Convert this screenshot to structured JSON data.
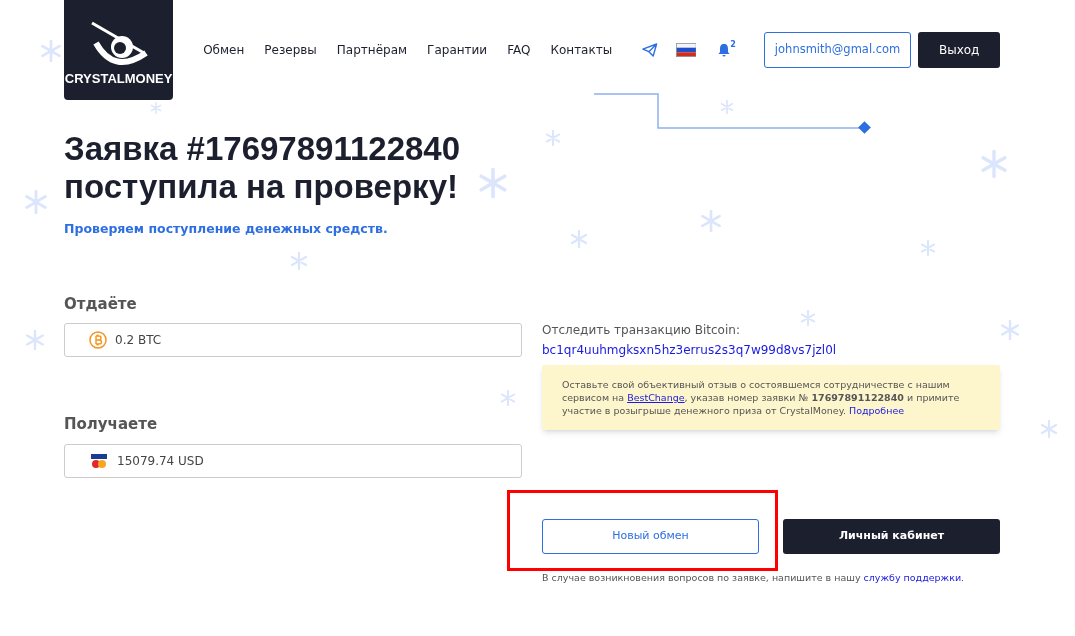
{
  "header": {
    "logo_text": "CRYSTALMONEY",
    "nav": [
      {
        "label": "Обмен"
      },
      {
        "label": "Резервы"
      },
      {
        "label": "Партнёрам"
      },
      {
        "label": "Гарантии"
      },
      {
        "label": "FAQ"
      },
      {
        "label": "Контакты"
      }
    ],
    "notifications_count": "2",
    "user_email": "johnsmith@gmal.com",
    "logout_button": "Выход"
  },
  "title_lines": [
    "Заявка #17697891122840",
    "поступила на проверку!"
  ],
  "subtitle": "Проверяем поступление денежных средств.",
  "give": {
    "label": "Отдаёте",
    "value": "0.2 BTC",
    "kind": "crypto"
  },
  "receive": {
    "label": "Получаете",
    "value": "15079.74 USD",
    "kind": "card"
  },
  "track": {
    "label": "Отследить транзакцию Bitcoin:",
    "address": "bc1qr4uuhmgksxn5hz3errus2s3q7w99d8vs7jzl0l"
  },
  "notice": [
    {
      "kind": "text",
      "text": "Оставьте свой объективный отзыв о состоявшемся сотрудничестве с нашим сервисом на "
    },
    {
      "kind": "link",
      "text": "BestChange",
      "underline": true
    },
    {
      "kind": "text",
      "text": ", указав номер заявки № **17697891122840** и примите участие в розыгрыше денежного приза от CrystalMoney. "
    },
    {
      "kind": "link",
      "text": "Подробнее",
      "underline": false
    }
  ],
  "new_exchange_button": {
    "label": "Новый обмен",
    "highlighted": true
  },
  "cabinet_button": "Личный кабинет",
  "footer_note": [
    {
      "kind": "text",
      "text": "В случае возникновения вопросов по заявке, напишите в нашу "
    },
    {
      "kind": "link",
      "text": "службу поддержки",
      "underline": false
    },
    {
      "kind": "text",
      "text": "."
    }
  ]
}
